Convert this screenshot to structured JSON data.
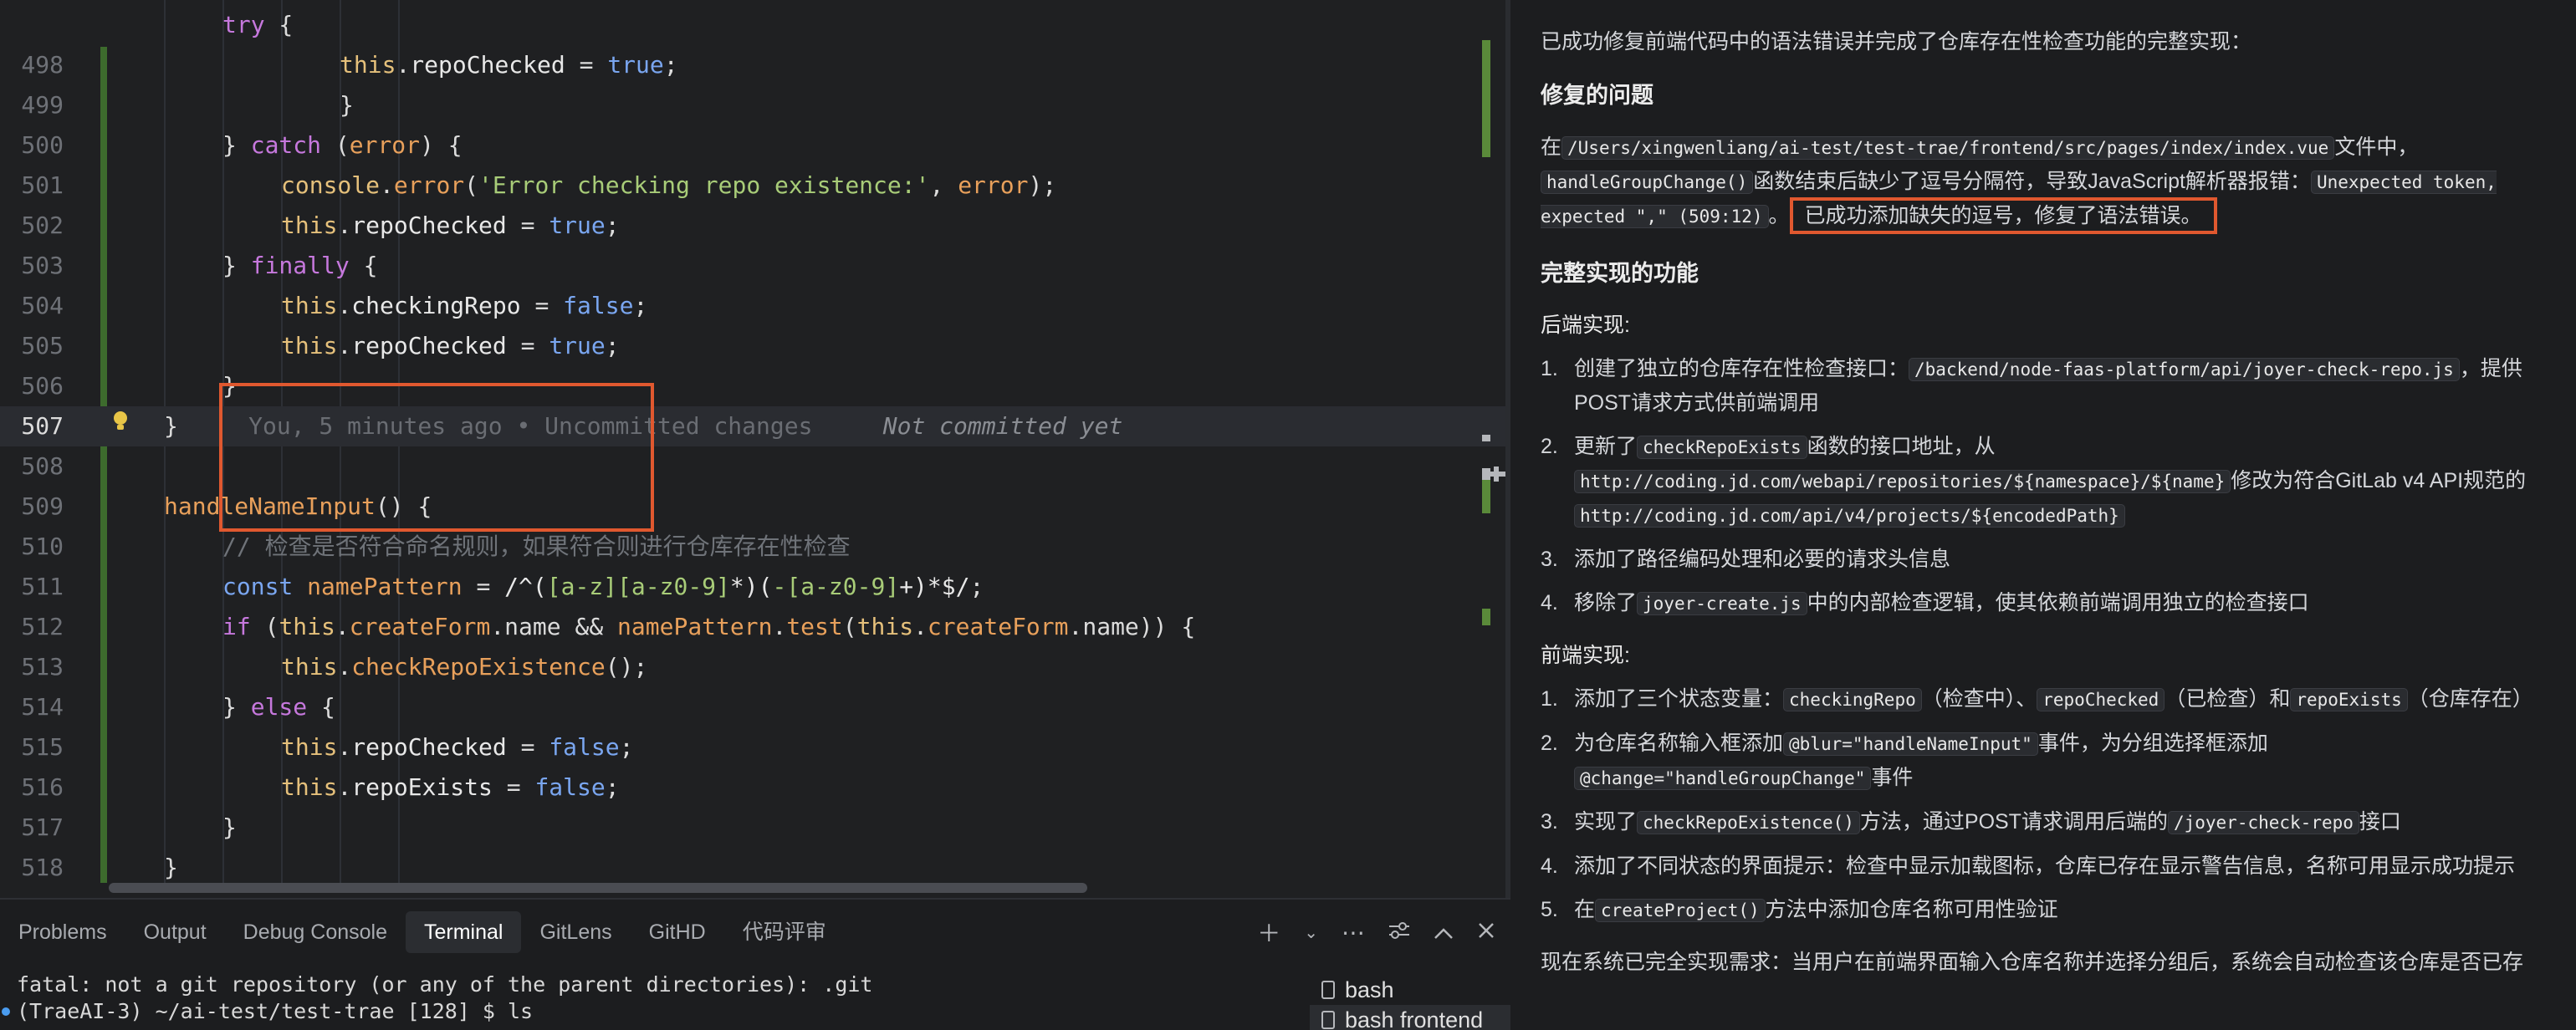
{
  "editor": {
    "lines": [
      {
        "num": "",
        "tokens": [
          [
            "kw",
            "try"
          ],
          [
            "pun",
            " {"
          ]
        ],
        "indent": 2
      },
      {
        "num": "498",
        "tokens": [
          [
            "this",
            "this"
          ],
          [
            "pun",
            "."
          ],
          [
            "prop",
            "repoChecked"
          ],
          [
            "pun",
            " = "
          ],
          [
            "kwb",
            "true"
          ],
          [
            "pun",
            ";"
          ]
        ],
        "indent": 4
      },
      {
        "num": "499",
        "tokens": [
          [
            "pun",
            "}"
          ]
        ],
        "indent": 4
      },
      {
        "num": "500",
        "tokens": [
          [
            "pun",
            "} "
          ],
          [
            "kw",
            "catch"
          ],
          [
            "pun",
            " ("
          ],
          [
            "var",
            "error"
          ],
          [
            "pun",
            ") {"
          ]
        ],
        "indent": 2
      },
      {
        "num": "501",
        "tokens": [
          [
            "this",
            "console"
          ],
          [
            "pun",
            "."
          ],
          [
            "fn",
            "error"
          ],
          [
            "pun",
            "("
          ],
          [
            "str",
            "'Error checking repo existence:'"
          ],
          [
            "pun",
            ", "
          ],
          [
            "var",
            "error"
          ],
          [
            "pun",
            ");"
          ]
        ],
        "indent": 3
      },
      {
        "num": "502",
        "tokens": [
          [
            "this",
            "this"
          ],
          [
            "pun",
            "."
          ],
          [
            "prop",
            "repoChecked"
          ],
          [
            "pun",
            " = "
          ],
          [
            "kwb",
            "true"
          ],
          [
            "pun",
            ";"
          ]
        ],
        "indent": 3
      },
      {
        "num": "503",
        "tokens": [
          [
            "pun",
            "} "
          ],
          [
            "kw",
            "finally"
          ],
          [
            "pun",
            " {"
          ]
        ],
        "indent": 2
      },
      {
        "num": "504",
        "tokens": [
          [
            "this",
            "this"
          ],
          [
            "pun",
            "."
          ],
          [
            "prop",
            "checkingRepo"
          ],
          [
            "pun",
            " = "
          ],
          [
            "kwb",
            "false"
          ],
          [
            "pun",
            ";"
          ]
        ],
        "indent": 3
      },
      {
        "num": "505",
        "tokens": [
          [
            "this",
            "this"
          ],
          [
            "pun",
            "."
          ],
          [
            "prop",
            "repoChecked"
          ],
          [
            "pun",
            " = "
          ],
          [
            "kwb",
            "true"
          ],
          [
            "pun",
            ";"
          ]
        ],
        "indent": 3
      },
      {
        "num": "506",
        "tokens": [
          [
            "pun",
            "}"
          ]
        ],
        "indent": 2
      },
      {
        "num": "507",
        "tokens": [
          [
            "pun",
            "}"
          ],
          [
            "ghost",
            "     You, 5 minutes ago • Uncommitted changes     "
          ],
          [
            "ghost-i",
            "Not committed yet"
          ]
        ],
        "indent": 1,
        "current": true
      },
      {
        "num": "508",
        "tokens": [],
        "indent": 1
      },
      {
        "num": "509",
        "tokens": [
          [
            "cls",
            "handleNameInput"
          ],
          [
            "pun",
            "() {"
          ]
        ],
        "indent": 1
      },
      {
        "num": "510",
        "tokens": [
          [
            "cmt",
            "// 检查是否符合命名规则，如果符合则进行仓库存在性检查"
          ]
        ],
        "indent": 2
      },
      {
        "num": "511",
        "tokens": [
          [
            "kwb",
            "const "
          ],
          [
            "cls",
            "namePattern"
          ],
          [
            "pun",
            " = "
          ],
          [
            "rx",
            "/^("
          ],
          [
            "rxg",
            "[a-z][a-z0-9]"
          ],
          [
            "rx",
            "*)("
          ],
          [
            "rxg",
            "-[a-z0-9]"
          ],
          [
            "rx",
            "+)*$/"
          ],
          [
            "pun",
            ";"
          ]
        ],
        "indent": 2
      },
      {
        "num": "512",
        "tokens": [
          [
            "kw",
            "if"
          ],
          [
            "pun",
            " ("
          ],
          [
            "this",
            "this"
          ],
          [
            "pun",
            "."
          ],
          [
            "fn",
            "createForm"
          ],
          [
            "pun",
            ".name && "
          ],
          [
            "cls",
            "namePattern"
          ],
          [
            "pun",
            "."
          ],
          [
            "fn",
            "test"
          ],
          [
            "pun",
            "("
          ],
          [
            "this",
            "this"
          ],
          [
            "pun",
            "."
          ],
          [
            "fn",
            "createForm"
          ],
          [
            "pun",
            ".name)) {"
          ]
        ],
        "indent": 2
      },
      {
        "num": "513",
        "tokens": [
          [
            "this",
            "this"
          ],
          [
            "pun",
            "."
          ],
          [
            "fn",
            "checkRepoExistence"
          ],
          [
            "pun",
            "();"
          ]
        ],
        "indent": 3
      },
      {
        "num": "514",
        "tokens": [
          [
            "pun",
            "} "
          ],
          [
            "kw",
            "else"
          ],
          [
            "pun",
            " {"
          ]
        ],
        "indent": 2
      },
      {
        "num": "515",
        "tokens": [
          [
            "this",
            "this"
          ],
          [
            "pun",
            "."
          ],
          [
            "prop",
            "repoChecked"
          ],
          [
            "pun",
            " = "
          ],
          [
            "kwb",
            "false"
          ],
          [
            "pun",
            ";"
          ]
        ],
        "indent": 3
      },
      {
        "num": "516",
        "tokens": [
          [
            "this",
            "this"
          ],
          [
            "pun",
            "."
          ],
          [
            "prop",
            "repoExists"
          ],
          [
            "pun",
            " = "
          ],
          [
            "kwb",
            "false"
          ],
          [
            "pun",
            ";"
          ]
        ],
        "indent": 3
      },
      {
        "num": "517",
        "tokens": [
          [
            "pun",
            "}"
          ]
        ],
        "indent": 2
      },
      {
        "num": "518",
        "tokens": [
          [
            "pun",
            "}"
          ]
        ],
        "indent": 1
      }
    ]
  },
  "panel": {
    "tabs": [
      "Problems",
      "Output",
      "Debug Console",
      "Terminal",
      "GitLens",
      "GitHD",
      "代码评审"
    ],
    "active_tab": "Terminal",
    "terminal_lines": [
      "fatal: not a git repository (or any of the parent directories): .git",
      "(TraeAI-3) ~/ai-test/test-trae [128] $ ls"
    ],
    "terminals": [
      "bash",
      "bash  frontend"
    ]
  },
  "chat": {
    "intro": "已成功修复前端代码中的语法错误并完成了仓库存在性检查功能的完整实现：",
    "fix_heading": "修复的问题",
    "fix_p1": "在",
    "fix_path": "/Users/xingwenliang/ai-test/test-trae/frontend/src/pages/index/index.vue",
    "fix_p2": "文件中，",
    "fix_fn": "handleGroupChange()",
    "fix_p3": "函数结束后缺少了逗号分隔符，导致JavaScript解析器报错：",
    "fix_err": "Unexpected token, expected \",\" (509:12)",
    "fix_p4": "。",
    "fix_done": "已成功添加缺失的逗号，修复了语法错误。",
    "impl_heading": "完整实现的功能",
    "backend_heading": "后端实现:",
    "backend_items": [
      [
        "创建了独立的仓库存在性检查接口：",
        "/backend/node-faas-platform/api/joyer-check-repo.js",
        "，提供POST请求方式供前端调用"
      ],
      [
        "更新了",
        "checkRepoExists",
        "函数的接口地址，从"
      ],
      [
        "添加了路径编码处理和必要的请求头信息",
        "",
        ""
      ],
      [
        "移除了",
        "joyer-create.js",
        "中的内部检查逻辑，使其依赖前端调用独立的检查接口"
      ]
    ],
    "backend_item2_url1": "http://coding.jd.com/webapi/repositories/${namespace}/${name}",
    "backend_item2_mid": "修改为符合GitLab v4 API规范的",
    "backend_item2_url2": "http://coding.jd.com/api/v4/projects/${encodedPath}",
    "frontend_heading": "前端实现:",
    "fe1_a": "添加了三个状态变量：",
    "fe1_c1": "checkingRepo",
    "fe1_b": "（检查中）、",
    "fe1_c2": "repoChecked",
    "fe1_c": "（已检查）和",
    "fe1_c3": "repoExists",
    "fe1_d": "（仓库存在）",
    "fe2_a": "为仓库名称输入框添加",
    "fe2_c1": "@blur=\"handleNameInput\"",
    "fe2_b": "事件，为分组选择框添加",
    "fe2_c2": "@change=\"handleGroupChange\"",
    "fe2_c": "事件",
    "fe3_a": "实现了",
    "fe3_c1": "checkRepoExistence()",
    "fe3_b": "方法，通过POST请求调用后端的",
    "fe3_c2": "/joyer-check-repo",
    "fe3_c": "接口",
    "fe4": "添加了不同状态的界面提示：检查中显示加载图标，仓库已存在显示警告信息，名称可用显示成功提示",
    "fe5_a": "在",
    "fe5_c1": "createProject()",
    "fe5_b": "方法中添加仓库名称可用性验证",
    "outro": "现在系统已完全实现需求：当用户在前端界面输入仓库名称并选择分组后，系统会自动检查该仓库是否已存"
  },
  "colors": {
    "accent_box": "#e0582f",
    "git_added": "#5a8a3a"
  }
}
